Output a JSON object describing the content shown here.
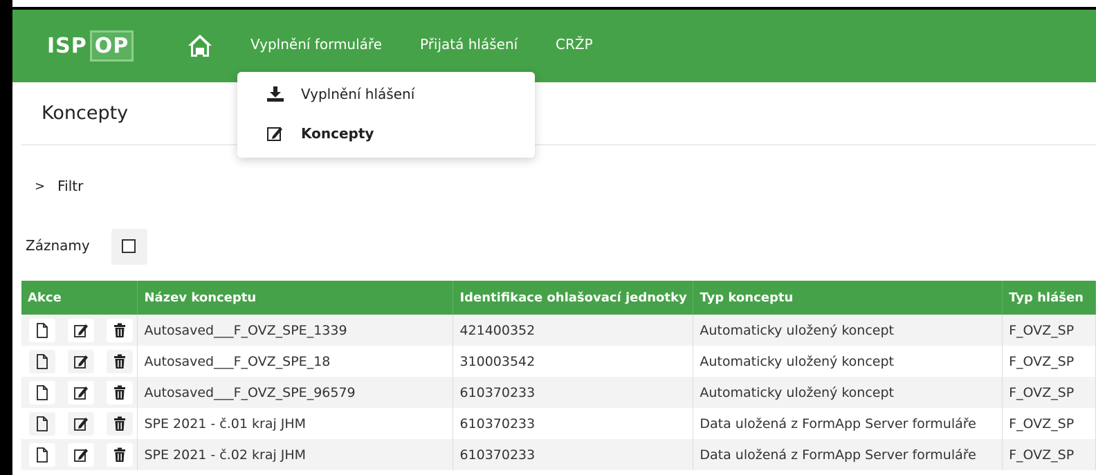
{
  "header": {
    "logo_text": "ISPOP",
    "nav": {
      "item1": "Vyplnění formuláře",
      "item2": "Přijatá hlášení",
      "item3": "CRŽP"
    }
  },
  "dropdown": {
    "item1": "Vyplnění hlášení",
    "item2": "Koncepty"
  },
  "page": {
    "title": "Koncepty",
    "filter_label": "Filtr",
    "records_label": "Záznamy"
  },
  "table": {
    "headers": {
      "actions": "Akce",
      "name": "Název konceptu",
      "unit": "Identifikace ohlašovací jednotky",
      "type": "Typ konceptu",
      "report_type": "Typ hlášen"
    },
    "rows": [
      {
        "name": "Autosaved___F_OVZ_SPE_1339",
        "unit": "421400352",
        "type": "Automaticky uložený koncept",
        "report_type": "F_OVZ_SP"
      },
      {
        "name": "Autosaved___F_OVZ_SPE_18",
        "unit": "310003542",
        "type": "Automaticky uložený koncept",
        "report_type": "F_OVZ_SP"
      },
      {
        "name": "Autosaved___F_OVZ_SPE_96579",
        "unit": "610370233",
        "type": "Automaticky uložený koncept",
        "report_type": "F_OVZ_SP"
      },
      {
        "name": "SPE 2021 - č.01 kraj JHM",
        "unit": "610370233",
        "type": "Data uložená z FormApp Server formuláře",
        "report_type": "F_OVZ_SP"
      },
      {
        "name": "SPE 2021 - č.02 kraj JHM",
        "unit": "610370233",
        "type": "Data uložená z FormApp Server formuláře",
        "report_type": "F_OVZ_SP"
      }
    ]
  },
  "colors": {
    "brand_green": "#45a248",
    "row_alt": "#f3f3f3"
  }
}
